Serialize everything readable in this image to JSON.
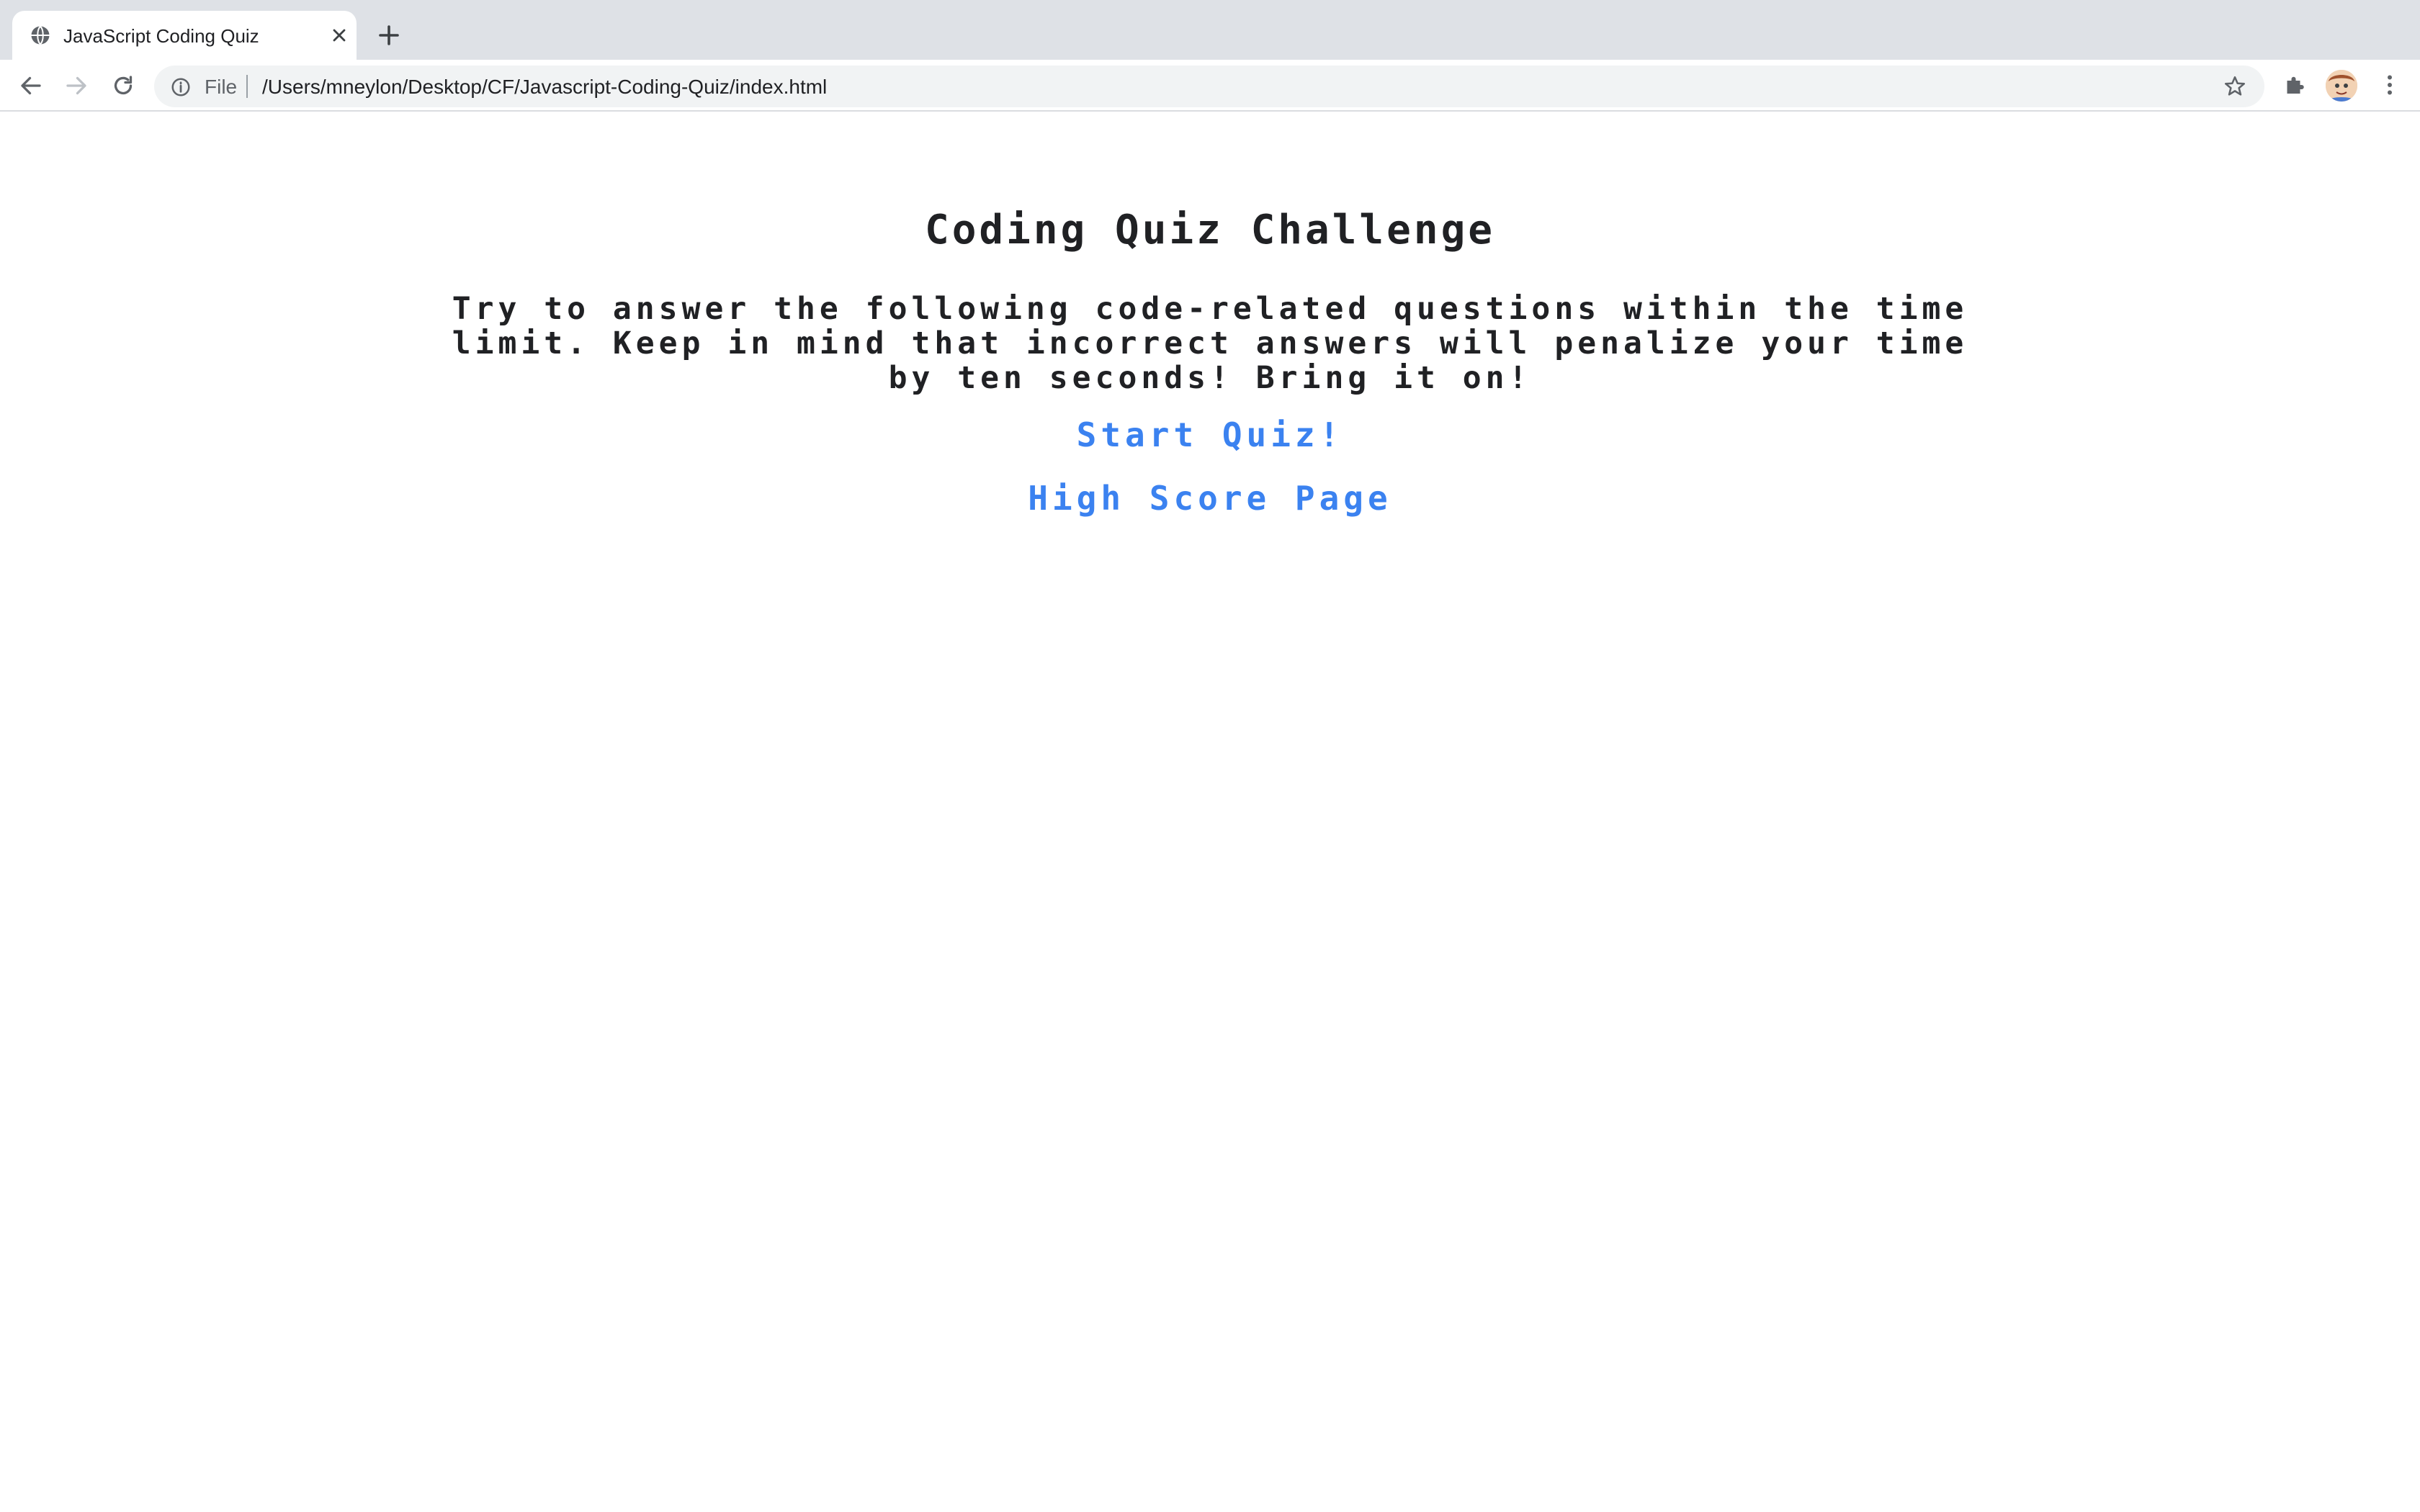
{
  "browser": {
    "tab": {
      "title": "JavaScript Coding Quiz"
    },
    "address_bar": {
      "scheme_label": "File",
      "url": "/Users/mneylon/Desktop/CF/Javascript-Coding-Quiz/index.html"
    },
    "icons": {
      "tab_favicon": "globe-icon",
      "tab_close": "close-icon",
      "new_tab": "plus-icon",
      "back": "arrow-back-icon",
      "forward": "arrow-forward-icon",
      "reload": "reload-icon",
      "site_info": "info-icon",
      "bookmark": "star-icon",
      "extensions": "puzzle-icon",
      "profile": "avatar",
      "menu": "more-vert-icon"
    }
  },
  "page": {
    "title": "Coding Quiz Challenge",
    "intro": "Try to answer the following code-related questions within the time limit. Keep in mind that incorrect answers will penalize your time by ten seconds! Bring it on!",
    "start_link": "Start Quiz!",
    "highscore_link": "High Score Page"
  },
  "colors": {
    "chrome_bg": "#dee1e6",
    "link": "#3b82f0",
    "text": "#202124"
  }
}
